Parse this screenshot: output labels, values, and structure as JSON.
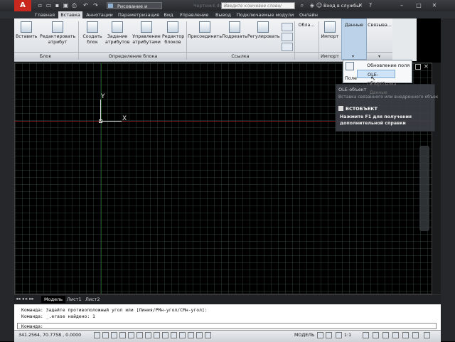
{
  "titlebar": {
    "app_button": "A",
    "workspace": "Рисование и аннотации",
    "document_title": "Чертеж4.dwg",
    "search_placeholder": "Введите ключевое слово/фразу",
    "signin": "Вход в службы"
  },
  "tabs": [
    "Главная",
    "Вставка",
    "Аннотации",
    "Параметризация",
    "Вид",
    "Управление",
    "Вывод",
    "Подключаемые модули",
    "Онлайн"
  ],
  "active_tab": "Вставка",
  "ribbon": {
    "block_panel": {
      "title": "Блок",
      "buttons": [
        "Вставить",
        "Редактировать\nатрибут"
      ]
    },
    "blockdef_panel": {
      "title": "Определение блока",
      "buttons": [
        "Создать\nблок",
        "Задание\nатрибутов",
        "Управление\nатрибутами",
        "Редактор\nблоков"
      ]
    },
    "reference_panel": {
      "title": "Ссылка",
      "buttons": [
        "Присоединить",
        "Подрезать",
        "Регулировать"
      ]
    },
    "cloud_label": "Обла...",
    "import_panel": {
      "title": "Импорт",
      "button": "Импорт"
    },
    "data_panel": {
      "label": "Данные"
    },
    "link_panel": {
      "label": "Связыва..."
    }
  },
  "menu": {
    "field_label": "Поле",
    "items": [
      "Обновление поля",
      "OLE-объект",
      "Гиперссылка",
      "Данные"
    ]
  },
  "tooltip": {
    "title_line": "OLE-объект",
    "description": "Вставка связанного или внедренного объекта",
    "command": "ВСТОБЪЕКТ",
    "help": "Нажмите F1 для получения дополнительной справки"
  },
  "ucs": {
    "x": "X",
    "y": "Y"
  },
  "layout_tabs": [
    "Модель",
    "Лист1",
    "Лист2"
  ],
  "command": {
    "history": [
      "Команда: Задайте противоположный угол или [Линия/РМн-угол/СМн-угол]:",
      "Команда: _.erase найдено: 1"
    ],
    "prompt": "Команда:"
  },
  "status": {
    "coordinates": "341.2564, 70.7758 , 0.0000",
    "model": "МОДЕЛЬ",
    "scale": "1:1"
  }
}
